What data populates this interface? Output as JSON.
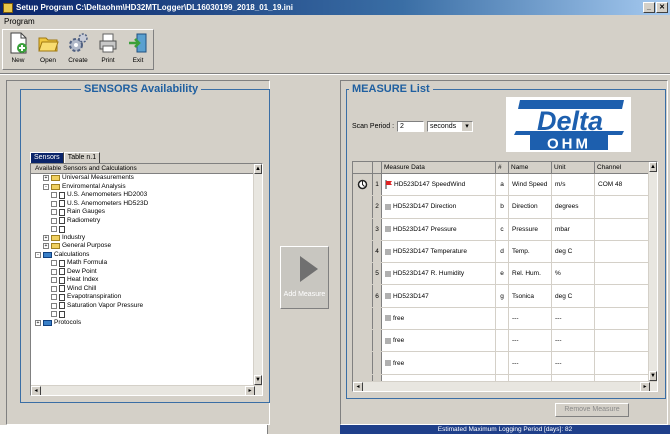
{
  "window": {
    "title": "Setup Program  C:\\Deltaohm\\HD32MTLogger\\DL16030199_2018_01_19.ini",
    "icon": "setup-app-icon"
  },
  "menu": {
    "items": [
      "Program"
    ]
  },
  "toolbar": {
    "buttons": [
      {
        "label": "New",
        "icon": "new-file-icon"
      },
      {
        "label": "Open",
        "icon": "folder-open-icon"
      },
      {
        "label": "Create",
        "icon": "gears-icon"
      },
      {
        "label": "Print",
        "icon": "print-icon"
      },
      {
        "label": "Exit",
        "icon": "exit-icon"
      }
    ]
  },
  "sensors": {
    "title": "SENSORS Availability",
    "tabs": [
      "Sensors",
      "Table n.1"
    ],
    "tree_header": "Available Sensors and Calculations",
    "tree": [
      {
        "text": "Universal Measurements",
        "toggle": "+",
        "indent": 1,
        "type": "folder"
      },
      {
        "text": "Enviromental Analysis",
        "toggle": "-",
        "indent": 1,
        "type": "folder"
      },
      {
        "text": "U.S. Anemometers HD2003",
        "toggle": "",
        "indent": 2,
        "type": "doc"
      },
      {
        "text": "U.S. Anemometers HD523D",
        "toggle": "",
        "indent": 2,
        "type": "doc"
      },
      {
        "text": "Rain Gauges",
        "toggle": "",
        "indent": 2,
        "type": "doc"
      },
      {
        "text": "Radiometry",
        "toggle": "",
        "indent": 2,
        "type": "doc"
      },
      {
        "text": "",
        "toggle": "",
        "indent": 2,
        "type": "doc"
      },
      {
        "text": "Industry",
        "toggle": "+",
        "indent": 1,
        "type": "folder"
      },
      {
        "text": "General Purpose",
        "toggle": "+",
        "indent": 1,
        "type": "folder"
      },
      {
        "text": "Calculations",
        "toggle": "-",
        "indent": 0,
        "type": "bfolder"
      },
      {
        "text": "Math Formula",
        "toggle": "",
        "indent": 2,
        "type": "doc"
      },
      {
        "text": "Dew Point",
        "toggle": "",
        "indent": 2,
        "type": "doc"
      },
      {
        "text": "Heat Index",
        "toggle": "",
        "indent": 2,
        "type": "doc"
      },
      {
        "text": "Wind Chill",
        "toggle": "",
        "indent": 2,
        "type": "doc"
      },
      {
        "text": "Evapotranspiration",
        "toggle": "",
        "indent": 2,
        "type": "doc"
      },
      {
        "text": "Saturation Vapor Pressure",
        "toggle": "",
        "indent": 2,
        "type": "doc"
      },
      {
        "text": "",
        "toggle": "",
        "indent": 2,
        "type": "doc"
      },
      {
        "text": "Protocols",
        "toggle": "+",
        "indent": 0,
        "type": "bfolder"
      }
    ]
  },
  "add_button": {
    "label": "Add Measure",
    "icon": "right-arrow-icon"
  },
  "measure": {
    "title": "MEASURE List",
    "scan_label": "Scan Period :",
    "scan_value": "2",
    "scan_unit": "seconds",
    "logo_top": "Delta",
    "logo_bottom": "OHM",
    "columns": [
      "",
      "",
      "Measure Data",
      "#",
      "Name",
      "Unit",
      "Channel"
    ],
    "rows": [
      {
        "n": "1",
        "data": "HD523D147 SpeedWind",
        "id": "a",
        "name": "Wind Speed",
        "unit": "m/s",
        "channel": "COM 48",
        "first": true
      },
      {
        "n": "2",
        "data": "HD523D147 Direction",
        "id": "b",
        "name": "Direction",
        "unit": "degrees",
        "channel": "",
        "first": false
      },
      {
        "n": "3",
        "data": "HD523D147 Pressure",
        "id": "c",
        "name": "Pressure",
        "unit": "mbar",
        "channel": "",
        "first": false
      },
      {
        "n": "4",
        "data": "HD523D147 Temperature",
        "id": "d",
        "name": "Temp.",
        "unit": "deg C",
        "channel": "",
        "first": false
      },
      {
        "n": "5",
        "data": "HD523D147 R. Humidity",
        "id": "e",
        "name": "Rel. Hum.",
        "unit": "%",
        "channel": "",
        "first": false
      },
      {
        "n": "6",
        "data": "HD523D147",
        "id": "g",
        "name": "Tsonica",
        "unit": "deg C",
        "channel": "",
        "first": false
      },
      {
        "n": "",
        "data": "free",
        "id": "",
        "name": "---",
        "unit": "---",
        "channel": "",
        "first": false
      },
      {
        "n": "",
        "data": "free",
        "id": "",
        "name": "---",
        "unit": "---",
        "channel": "",
        "first": false
      },
      {
        "n": "",
        "data": "free",
        "id": "",
        "name": "---",
        "unit": "---",
        "channel": "",
        "first": false
      },
      {
        "n": "",
        "data": "free",
        "id": "",
        "name": "",
        "unit": "",
        "channel": "",
        "first": false
      }
    ],
    "remove_label": "Remove Measure"
  },
  "status": {
    "logging": "Estimated Maximum Logging Period [days]: 82"
  },
  "colors": {
    "accent": "#1f5fa0",
    "title_bar": "#0a246a",
    "status_bar": "#1f3f8a",
    "logo_blue": "#1d5fae"
  }
}
